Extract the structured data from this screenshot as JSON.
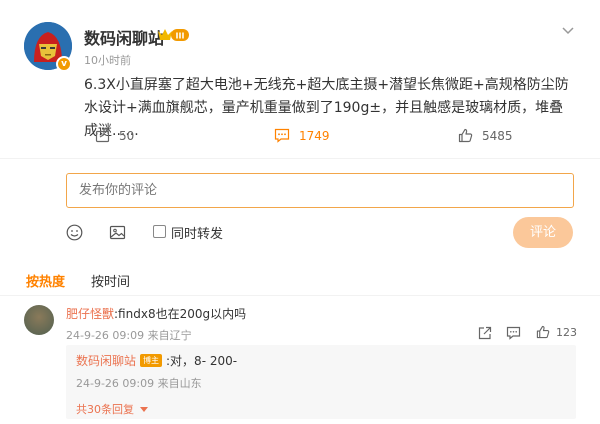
{
  "post": {
    "author": "数码闲聊站",
    "level_badge": "III",
    "time": "10小时前",
    "verified_mark": "v",
    "text": "6.3X小直屏塞了超大电池+无线充+超大底主摄+潜望长焦微距+高规格防尘防水设计+满血旗舰芯，量产机重量做到了190g±，并且触感是玻璃材质，堆叠成谜......",
    "repost_count": "50",
    "comment_count": "1749",
    "like_count": "5485"
  },
  "composer": {
    "placeholder": "发布你的评论",
    "also_repost_label": "同时转发",
    "submit_label": "评论"
  },
  "sort": {
    "hot_label": "按热度",
    "time_label": "按时间"
  },
  "comments": [
    {
      "user": "肥仔怪獸",
      "text": ":findx8也在200g以内吗",
      "meta": "24-9-26 09:09 来自辽宁",
      "like_count": "123",
      "replies": [
        {
          "user": "数码闲聊站",
          "badge": "博主",
          "text": ":对，8- 200-",
          "meta": "24-9-26 09:09 来自山东"
        }
      ],
      "more_replies_label": "共30条回复"
    }
  ],
  "colors": {
    "accent": "#ff8200",
    "username": "#eb7350",
    "submit_disabled": "#fbc89a"
  }
}
